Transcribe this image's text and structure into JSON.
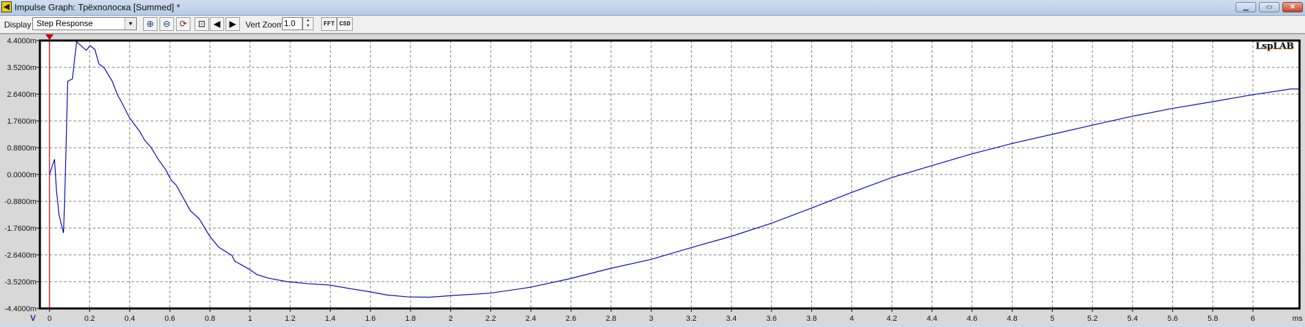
{
  "window": {
    "title": "Impulse Graph: Трёхполоска [Summed] *",
    "minimize_icon": "minimize-icon",
    "maximize_icon": "maximize-icon",
    "close_icon": "close-icon"
  },
  "toolbar": {
    "display_label": "Display",
    "display_value": "Step Response",
    "buttons": [
      "zoom-in-icon",
      "zoom-out-icon",
      "zoom-reset-icon",
      "zoom-fit-icon",
      "arrow-left-icon",
      "arrow-right-icon"
    ],
    "vert_zoom_label": "Vert Zoom",
    "vert_zoom_value": "1.0",
    "fft_label": "FFT",
    "csd_label": "CSD"
  },
  "logo": "LspLAB",
  "colors": {
    "trace": "#0000cc",
    "marker": "#cc0000",
    "grid": "#808080"
  },
  "chart_data": {
    "type": "line",
    "title": "Step Response",
    "xlabel": "ms",
    "ylabel": "V",
    "xlim": [
      0,
      6.23
    ],
    "ylim": [
      -4.4,
      4.4
    ],
    "grid": true,
    "marker_x": 0,
    "y_ticks": [
      4.4,
      3.52,
      2.64,
      1.76,
      0.88,
      0.0,
      -0.88,
      -1.76,
      -2.64,
      -3.52,
      -4.4
    ],
    "y_tick_labels": [
      "4.4000m",
      "3.5200m",
      "2.6400m",
      "1.7600m",
      "0.8800m",
      "0.0000m",
      "-0.8800m",
      "-1.7600m",
      "-2.6400m",
      "-3.5200m",
      "-4.4000m"
    ],
    "x_tick_labels": [
      "0",
      "0.2",
      "0.4",
      "0.6",
      "0.8",
      "1",
      "1.2",
      "1.4",
      "1.6",
      "1.8",
      "2",
      "2.2",
      "2.4",
      "2.6",
      "2.8",
      "3",
      "3.2",
      "3.4",
      "3.6",
      "3.8",
      "4",
      "4.2",
      "4.4",
      "4.6",
      "4.8",
      "5",
      "5.2",
      "5.4",
      "5.6",
      "5.8",
      "6"
    ],
    "series": [
      {
        "name": "Summed",
        "points": [
          [
            0,
            0
          ],
          [
            0.025,
            0.5
          ],
          [
            0.035,
            -0.55
          ],
          [
            0.048,
            -1.34
          ],
          [
            0.07,
            -1.92
          ],
          [
            0.072,
            -1.53
          ],
          [
            0.075,
            -0.85
          ],
          [
            0.08,
            0.16
          ],
          [
            0.086,
            1.82
          ],
          [
            0.091,
            3.06
          ],
          [
            0.114,
            3.14
          ],
          [
            0.135,
            4.36
          ],
          [
            0.183,
            4.08
          ],
          [
            0.203,
            4.23
          ],
          [
            0.226,
            4.11
          ],
          [
            0.247,
            3.63
          ],
          [
            0.273,
            3.5
          ],
          [
            0.313,
            3.06
          ],
          [
            0.339,
            2.61
          ],
          [
            0.359,
            2.38
          ],
          [
            0.399,
            1.86
          ],
          [
            0.45,
            1.41
          ],
          [
            0.473,
            1.14
          ],
          [
            0.507,
            0.88
          ],
          [
            0.542,
            0.5
          ],
          [
            0.582,
            0.13
          ],
          [
            0.605,
            -0.17
          ],
          [
            0.633,
            -0.36
          ],
          [
            0.702,
            -1.19
          ],
          [
            0.746,
            -1.45
          ],
          [
            0.798,
            -2.02
          ],
          [
            0.844,
            -2.39
          ],
          [
            0.91,
            -2.66
          ],
          [
            0.923,
            -2.84
          ],
          [
            0.995,
            -3.11
          ],
          [
            1.035,
            -3.29
          ],
          [
            1.094,
            -3.41
          ],
          [
            1.185,
            -3.52
          ],
          [
            1.277,
            -3.58
          ],
          [
            1.395,
            -3.63
          ],
          [
            1.5,
            -3.75
          ],
          [
            1.605,
            -3.86
          ],
          [
            1.684,
            -3.96
          ],
          [
            1.789,
            -4.02
          ],
          [
            1.894,
            -4.03
          ],
          [
            2.025,
            -3.97
          ],
          [
            2.196,
            -3.9
          ],
          [
            2.393,
            -3.71
          ],
          [
            2.59,
            -3.43
          ],
          [
            2.8,
            -3.08
          ],
          [
            3.0,
            -2.79
          ],
          [
            3.2,
            -2.4
          ],
          [
            3.4,
            -2.03
          ],
          [
            3.6,
            -1.6
          ],
          [
            3.8,
            -1.1
          ],
          [
            4.0,
            -0.59
          ],
          [
            4.2,
            -0.1
          ],
          [
            4.4,
            0.29
          ],
          [
            4.6,
            0.68
          ],
          [
            4.8,
            1.02
          ],
          [
            5.0,
            1.32
          ],
          [
            5.2,
            1.62
          ],
          [
            5.39,
            1.9
          ],
          [
            5.59,
            2.16
          ],
          [
            5.79,
            2.38
          ],
          [
            5.99,
            2.61
          ],
          [
            6.19,
            2.81
          ],
          [
            6.23,
            2.81
          ]
        ]
      }
    ]
  }
}
